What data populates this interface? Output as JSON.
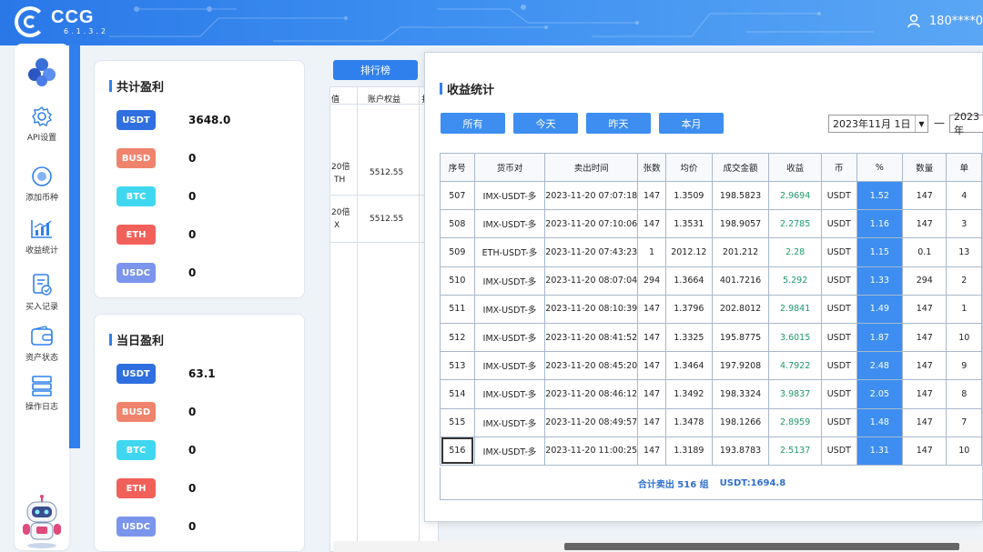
{
  "app": {
    "name": "CCG",
    "version": "6.1.3.2",
    "user": "180****0"
  },
  "sidebar": {
    "items": [
      {
        "label": "API设置",
        "icon": "gear-icon"
      },
      {
        "label": "添加币种",
        "icon": "coin-add-icon"
      },
      {
        "label": "收益统计",
        "icon": "chart-icon"
      },
      {
        "label": "买入记录",
        "icon": "record-icon"
      },
      {
        "label": "资产状态",
        "icon": "wallet-icon"
      },
      {
        "label": "操作日志",
        "icon": "log-icon"
      }
    ]
  },
  "total_profit": {
    "title": "共计盈利",
    "rows": [
      {
        "coin": "USDT",
        "value": "3648.0",
        "color": "#2f6fe0"
      },
      {
        "coin": "BUSD",
        "value": "0",
        "color": "#f0836b"
      },
      {
        "coin": "BTC",
        "value": "0",
        "color": "#3fd7f0"
      },
      {
        "coin": "ETH",
        "value": "0",
        "color": "#f2605a"
      },
      {
        "coin": "USDC",
        "value": "0",
        "color": "#7b95ec"
      }
    ]
  },
  "daily_profit": {
    "title": "当日盈利",
    "rows": [
      {
        "coin": "USDT",
        "value": "63.1",
        "color": "#2f6fe0"
      },
      {
        "coin": "BUSD",
        "value": "0",
        "color": "#f0836b"
      },
      {
        "coin": "BTC",
        "value": "0",
        "color": "#3fd7f0"
      },
      {
        "coin": "ETH",
        "value": "0",
        "color": "#f2605a"
      },
      {
        "coin": "USDC",
        "value": "0",
        "color": "#7b95ec"
      }
    ]
  },
  "ranking": {
    "button": "排行榜",
    "headers": [
      "值",
      "账户权益",
      "扌"
    ],
    "rows": [
      {
        "a": "20倍",
        "b": "TH",
        "equity": "5512.55"
      },
      {
        "a": "20倍",
        "b": "X",
        "equity": "5512.55"
      }
    ]
  },
  "modal": {
    "title": "收益统计",
    "filters": [
      "所有",
      "今天",
      "昨天",
      "本月"
    ],
    "date_from": "2023年11月 1日",
    "date_sep": "—",
    "date_to": "2023年",
    "headers": [
      "序号",
      "货币对",
      "卖出时间",
      "张数",
      "均价",
      "成交金额",
      "收益",
      "币",
      "%",
      "数量",
      "单"
    ],
    "rows": [
      [
        "507",
        "IMX-USDT-多",
        "2023-11-20 07:07:18",
        "147",
        "1.3509",
        "198.5823",
        "2.9694",
        "USDT",
        "1.52",
        "147",
        "4"
      ],
      [
        "508",
        "IMX-USDT-多",
        "2023-11-20 07:10:06",
        "147",
        "1.3531",
        "198.9057",
        "2.2785",
        "USDT",
        "1.16",
        "147",
        "3"
      ],
      [
        "509",
        "ETH-USDT-多",
        "2023-11-20 07:43:23",
        "1",
        "2012.12",
        "201.212",
        "2.28",
        "USDT",
        "1.15",
        "0.1",
        "13"
      ],
      [
        "510",
        "IMX-USDT-多",
        "2023-11-20 08:07:04",
        "294",
        "1.3664",
        "401.7216",
        "5.292",
        "USDT",
        "1.33",
        "294",
        "2"
      ],
      [
        "511",
        "IMX-USDT-多",
        "2023-11-20 08:10:39",
        "147",
        "1.3796",
        "202.8012",
        "2.9841",
        "USDT",
        "1.49",
        "147",
        "1"
      ],
      [
        "512",
        "IMX-USDT-多",
        "2023-11-20 08:41:52",
        "147",
        "1.3325",
        "195.8775",
        "3.6015",
        "USDT",
        "1.87",
        "147",
        "10"
      ],
      [
        "513",
        "IMX-USDT-多",
        "2023-11-20 08:45:20",
        "147",
        "1.3464",
        "197.9208",
        "4.7922",
        "USDT",
        "2.48",
        "147",
        "9"
      ],
      [
        "514",
        "IMX-USDT-多",
        "2023-11-20 08:46:12",
        "147",
        "1.3492",
        "198.3324",
        "3.9837",
        "USDT",
        "2.05",
        "147",
        "8"
      ],
      [
        "515",
        "IMX-USDT-多",
        "2023-11-20 08:49:57",
        "147",
        "1.3478",
        "198.1266",
        "2.8959",
        "USDT",
        "1.48",
        "147",
        "7"
      ],
      [
        "516",
        "IMX-USDT-多",
        "2023-11-20 11:00:25",
        "147",
        "1.3189",
        "193.8783",
        "2.5137",
        "USDT",
        "1.31",
        "147",
        "10"
      ]
    ],
    "summary_count": "合计卖出 516 组",
    "summary_usdt": "USDT:1694.8"
  }
}
